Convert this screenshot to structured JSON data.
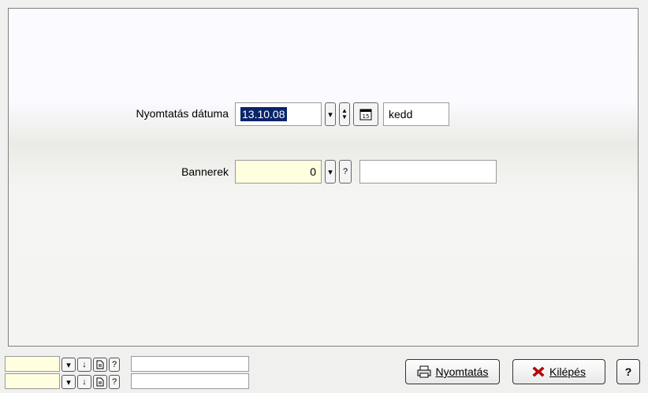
{
  "form": {
    "print_date": {
      "label": "Nyomtatás dátuma",
      "value": "13.10.08",
      "weekday": "kedd"
    },
    "banners": {
      "label": "Bannerek",
      "value": "0",
      "lookup_button": "?",
      "description": ""
    }
  },
  "footer": {
    "print_button": "Nyomtatás",
    "exit_button": "Kilépés",
    "help_button": "?",
    "lookup_rows": [
      {
        "value": "",
        "help": "?",
        "description": ""
      },
      {
        "value": "",
        "help": "?",
        "description": ""
      }
    ]
  },
  "icons": {
    "dropdown": "chevron-down-icon",
    "spinner": "spinner-up-down-icon",
    "calendar": "calendar-icon",
    "sort": "arrow-down-icon",
    "document": "document-icon",
    "print": "printer-icon",
    "exit": "red-x-icon"
  },
  "colors": {
    "highlight": "#0a246a",
    "input_yellow": "#ffffe0",
    "exit_red": "#cc0000"
  }
}
